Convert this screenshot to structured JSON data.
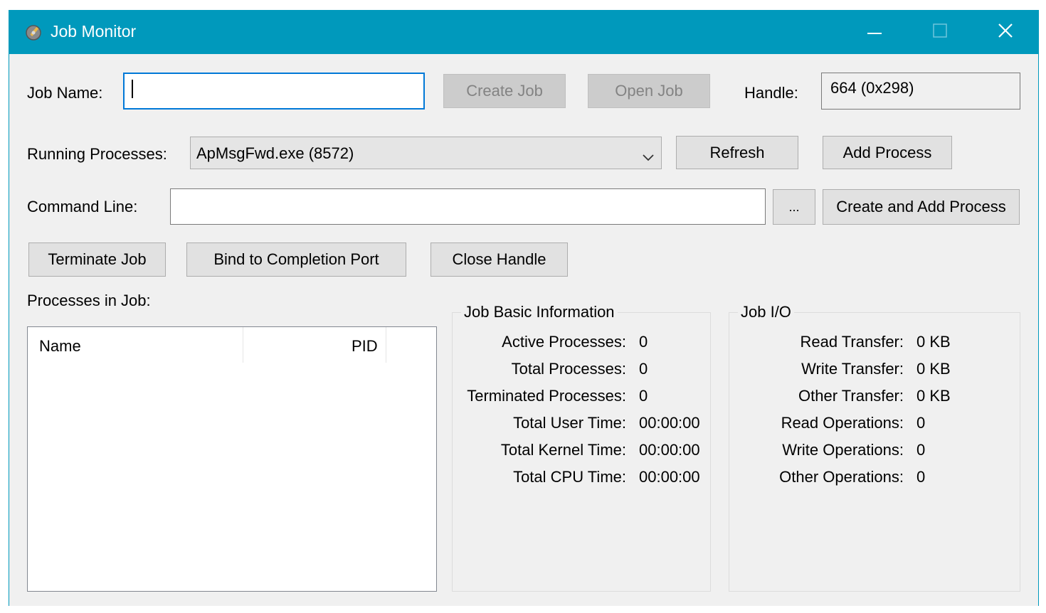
{
  "window": {
    "title": "Job Monitor",
    "controls": {
      "minimize": "—",
      "close": "✕"
    },
    "accent_color": "#0099bc"
  },
  "job_name": {
    "label": "Job Name:",
    "value": ""
  },
  "buttons": {
    "create_job": "Create Job",
    "open_job": "Open Job",
    "refresh": "Refresh",
    "add_process": "Add Process",
    "browse": "...",
    "create_and_add_process": "Create and Add Process",
    "terminate_job": "Terminate Job",
    "bind_completion_port": "Bind to Completion Port",
    "close_handle": "Close Handle"
  },
  "handle": {
    "label": "Handle:",
    "value": "664 (0x298)"
  },
  "running_processes": {
    "label": "Running Processes:",
    "selected": "ApMsgFwd.exe (8572)"
  },
  "command_line": {
    "label": "Command Line:",
    "value": ""
  },
  "processes_in_job": {
    "label": "Processes in Job:",
    "columns": [
      "Name",
      "PID"
    ],
    "rows": []
  },
  "job_basic_info": {
    "title": "Job Basic Information",
    "items": [
      {
        "label": "Active Processes:",
        "value": "0"
      },
      {
        "label": "Total Processes:",
        "value": "0"
      },
      {
        "label": "Terminated Processes:",
        "value": "0"
      },
      {
        "label": "Total User Time:",
        "value": "00:00:00"
      },
      {
        "label": "Total Kernel Time:",
        "value": "00:00:00"
      },
      {
        "label": "Total CPU Time:",
        "value": "00:00:00"
      }
    ]
  },
  "job_io": {
    "title": "Job I/O",
    "items": [
      {
        "label": "Read Transfer:",
        "value": "0 KB"
      },
      {
        "label": "Write Transfer:",
        "value": "0 KB"
      },
      {
        "label": "Other Transfer:",
        "value": "0 KB"
      },
      {
        "label": "Read Operations:",
        "value": "0"
      },
      {
        "label": "Write Operations:",
        "value": "0"
      },
      {
        "label": "Other Operations:",
        "value": "0"
      }
    ]
  }
}
